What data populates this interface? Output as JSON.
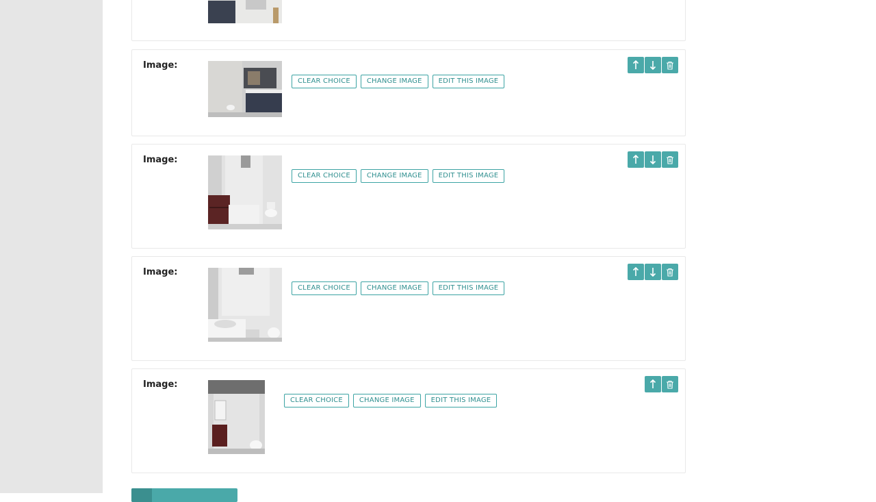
{
  "sidebar": {},
  "panels": [
    {
      "label": "",
      "buttons": [],
      "actions": []
    },
    {
      "label": "Image:",
      "buttons": [
        "CLEAR CHOICE",
        "CHANGE IMAGE",
        "EDIT THIS IMAGE"
      ],
      "actions": [
        "arrow-up-icon",
        "arrow-down-icon",
        "trash-icon"
      ]
    },
    {
      "label": "Image:",
      "buttons": [
        "CLEAR CHOICE",
        "CHANGE IMAGE",
        "EDIT THIS IMAGE"
      ],
      "actions": [
        "arrow-up-icon",
        "arrow-down-icon",
        "trash-icon"
      ]
    },
    {
      "label": "Image:",
      "buttons": [
        "CLEAR CHOICE",
        "CHANGE IMAGE",
        "EDIT THIS IMAGE"
      ],
      "actions": [
        "arrow-up-icon",
        "arrow-down-icon",
        "trash-icon"
      ]
    },
    {
      "label": "Image:",
      "buttons": [
        "CLEAR CHOICE",
        "CHANGE IMAGE",
        "EDIT THIS IMAGE"
      ],
      "actions": [
        "arrow-up-icon",
        "trash-icon"
      ]
    }
  ],
  "colors": {
    "accent": "#4aa9a9",
    "accent_dark": "#3b8f8f",
    "sidebar_bg": "#e6e6e6",
    "border": "#e8e8e8"
  }
}
